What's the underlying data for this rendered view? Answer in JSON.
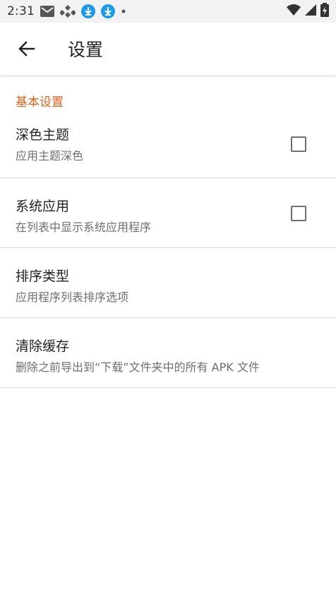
{
  "status_bar": {
    "time": "2:31",
    "icons": [
      "gmail-icon",
      "app-notification-icon",
      "download-icon",
      "download-icon",
      "dot-icon",
      "wifi-icon",
      "signal-icon",
      "battery-charging-icon"
    ]
  },
  "app_bar": {
    "back_icon": "arrow-back-icon",
    "title": "设置"
  },
  "section": {
    "header": "基本设置"
  },
  "prefs": [
    {
      "title": "深色主题",
      "summary": "应用主题深色",
      "checkbox": true,
      "checked": false
    },
    {
      "title": "系统应用",
      "summary": "在列表中显示系统应用程序",
      "checkbox": true,
      "checked": false
    },
    {
      "title": "排序类型",
      "summary": "应用程序列表排序选项",
      "checkbox": false
    },
    {
      "title": "清除缓存",
      "summary": "删除之前导出到“下载”文件夹中的所有 APK 文件",
      "checkbox": false
    }
  ],
  "colors": {
    "accent": "#e0601c",
    "status_bar_bg": "#f2f2f2",
    "download_badge": "#1e9be8"
  }
}
